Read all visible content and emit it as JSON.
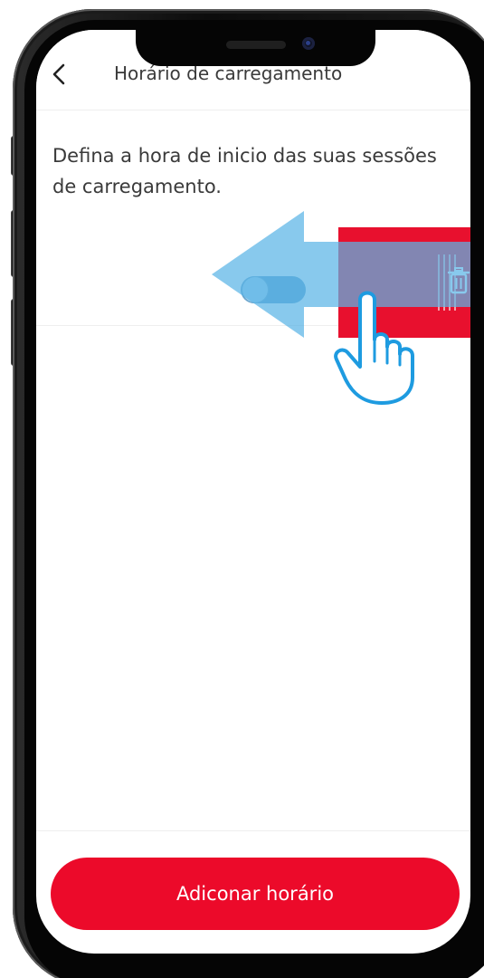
{
  "header": {
    "title": "Horário de carregamento",
    "back_icon": "chevron-left-icon"
  },
  "description": "Defina a hora de inicio das suas sessões de carregamento.",
  "schedule_item": {
    "toggle_on": false,
    "delete_icon": "trash-icon"
  },
  "overlay": {
    "gesture": "swipe-left",
    "arrow_color": "#5ab4e6",
    "hand_icon": "pointing-hand-icon"
  },
  "footer": {
    "add_button_label": "Adiconar horário"
  },
  "colors": {
    "brand_red": "#ec0a2a",
    "delete_red": "#e8102e",
    "text": "#3a3a3a"
  }
}
